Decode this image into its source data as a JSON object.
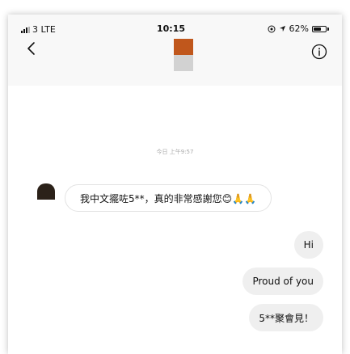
{
  "status_bar": {
    "signal": "3",
    "network": "LTE",
    "time": "10:15",
    "battery": "62%",
    "battery_level": 0.62
  },
  "header": {
    "back_icon": "chevron-left-icon",
    "info_icon": "info-circle-icon",
    "avatar_colors": [
      "#c0571c",
      "#d2d2d2"
    ]
  },
  "thread": {
    "timestamp": "今日 上午9:57",
    "incoming": [
      {
        "text": "我中文擺咗5**，真的非常感謝您😊🙏🙏"
      }
    ],
    "outgoing": [
      {
        "text": "Hi"
      },
      {
        "text": "Proud of you"
      },
      {
        "text": "5**聚會見！"
      }
    ]
  }
}
